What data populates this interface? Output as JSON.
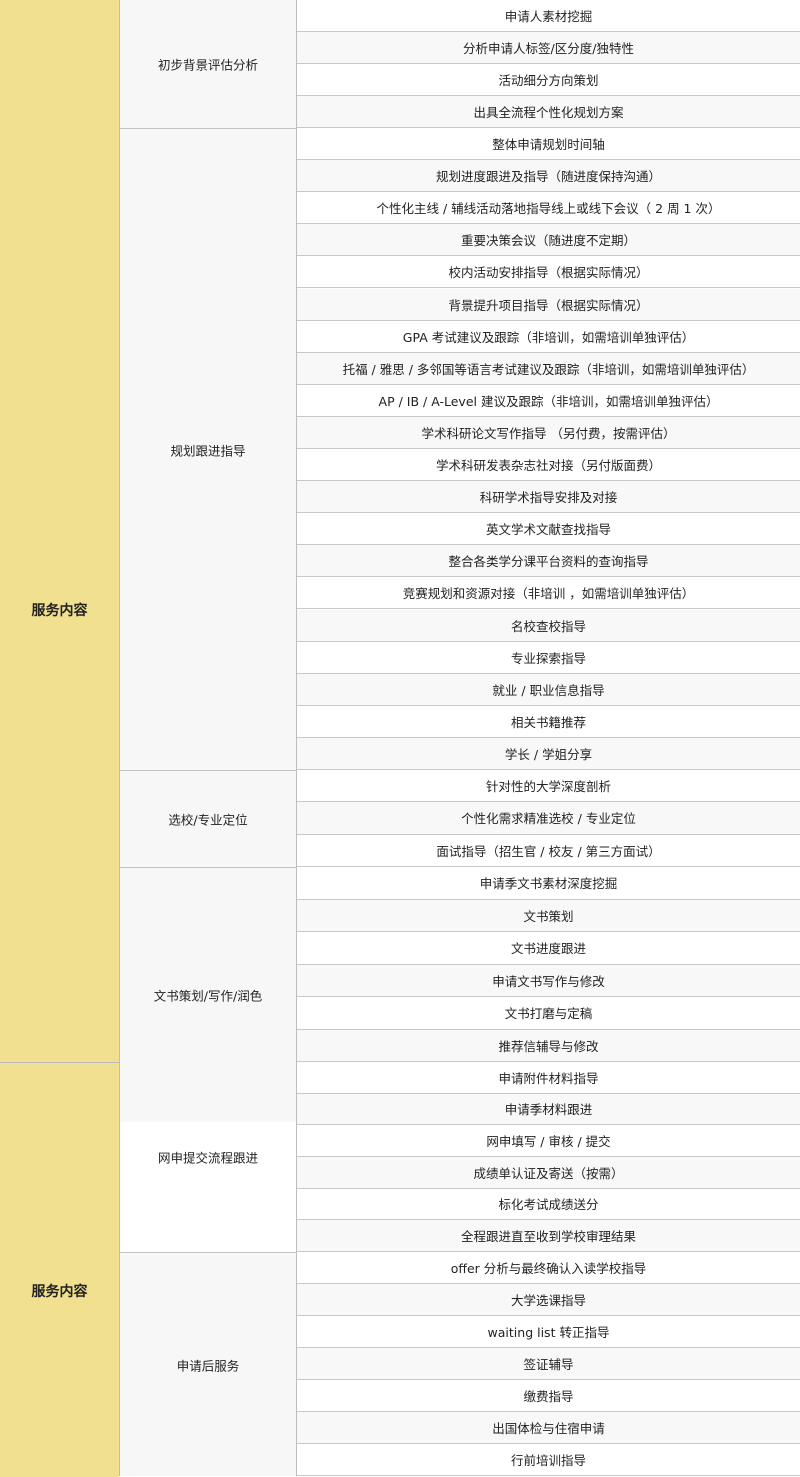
{
  "category_top": "服务内容",
  "category_bottom": "服务内容",
  "sections": [
    {
      "label": "初步背景评估分析",
      "items": [
        "申请人素材挖掘",
        "分析申请人标签/区分度/独特性",
        "活动细分方向策划",
        "出具全流程个性化规划方案"
      ]
    },
    {
      "label": "规划跟进指导",
      "items": [
        "整体申请规划时间轴",
        "规划进度跟进及指导（随进度保持沟通）",
        "个性化主线 / 辅线活动落地指导线上或线下会议（ 2 周 1 次）",
        "重要决策会议（随进度不定期）",
        "校内活动安排指导（根据实际情况）",
        "背景提升项目指导（根据实际情况）",
        "GPA 考试建议及跟踪（非培训，如需培训单独评估）",
        "托福 / 雅思 / 多邻国等语言考试建议及跟踪（非培训，如需培训单独评估）",
        "AP / IB / A-Level 建议及跟踪（非培训，如需培训单独评估）",
        "学术科研论文写作指导 （另付费，按需评估）",
        "学术科研发表杂志社对接（另付版面费）",
        "科研学术指导安排及对接",
        "英文学术文献查找指导",
        "整合各类学分课平台资料的查询指导",
        "竞赛规划和资源对接（非培训 ，如需培训单独评估）",
        "名校查校指导",
        "专业探索指导",
        "就业 / 职业信息指导",
        "相关书籍推荐",
        "学长 / 学姐分享"
      ]
    },
    {
      "label": "选校/专业定位",
      "items": [
        "针对性的大学深度剖析",
        "个性化需求精准选校 / 专业定位",
        "面试指导（招生官 / 校友 / 第三方面试）"
      ]
    },
    {
      "label": "文书策划/写作/润色",
      "items": [
        "申请季文书素材深度挖掘",
        "文书策划",
        "文书进度跟进",
        "申请文书写作与修改",
        "文书打磨与定稿",
        "推荐信辅导与修改"
      ]
    },
    {
      "label": "网申提交流程跟进",
      "items": [
        "申请附件材料指导",
        "申请季材料跟进",
        "网申填写 / 审核 / 提交",
        "成绩单认证及寄送（按需）",
        "标化考试成绩送分",
        "全程跟进直至收到学校审理结果"
      ]
    },
    {
      "label": "申请后服务",
      "items": [
        "offer 分析与最终确认入读学校指导",
        "大学选课指导",
        "waiting list 转正指导",
        "签证辅导",
        "缴费指导",
        "出国体检与住宿申请",
        "行前培训指导"
      ]
    }
  ]
}
